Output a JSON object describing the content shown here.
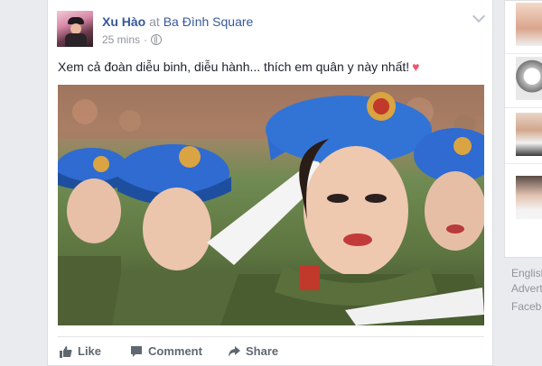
{
  "post": {
    "author": "Xu Hào",
    "at_word": "at",
    "place": "Ba Đình Square",
    "time": "25 mins",
    "dot": "·",
    "text": "Xem cả đoàn diễu binh, diễu hành... thích em quân y này nhất!",
    "heart": "♥",
    "photo_alt_icon": "photo-icon"
  },
  "actions": {
    "like": "Like",
    "comment": "Comment",
    "share": "Share"
  },
  "sidebar": {
    "footer_links": [
      "English",
      "Advert",
      "Facebo"
    ]
  },
  "colors": {
    "link": "#365899",
    "muted": "#90949c",
    "background": "#e9ebee",
    "heart": "#f25268",
    "beret": "#2f6bd0"
  }
}
